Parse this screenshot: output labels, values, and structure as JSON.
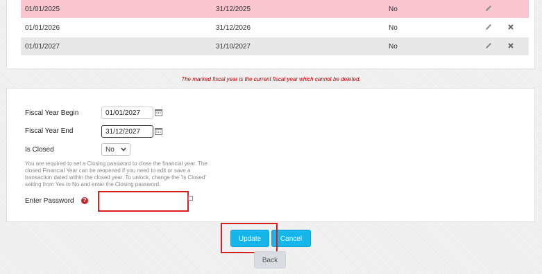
{
  "fiscal_years": [
    {
      "begin": "01/01/2025",
      "end": "31/12/2025",
      "closed": "No",
      "current": true
    },
    {
      "begin": "01/01/2026",
      "end": "31/12/2026",
      "closed": "No",
      "current": false
    },
    {
      "begin": "01/01/2027",
      "end": "31/10/2027",
      "closed": "No",
      "current": false
    }
  ],
  "warning": "The marked fiscal year is the current fiscal year which cannot be deleted.",
  "form": {
    "begin_label": "Fiscal Year Begin",
    "begin_value": "01/01/2027",
    "end_label": "Fiscal Year End",
    "end_value": "31/12/2027",
    "closed_label": "Is Closed",
    "closed_value": "No",
    "help_text": "You are required to set a Closing password to close the financial year. The closed Financial Year can be reopened if you need to edit or save a transaction dated within the closed year. To unlock, change the 'Is Closed' setting from Yes to No and enter the Closing password.",
    "password_label": "Enter Password",
    "password_help_glyph": "?",
    "password_value": ""
  },
  "buttons": {
    "update": "Update",
    "cancel": "Cancel",
    "back": "Back"
  },
  "colors": {
    "current_row": "#f9c6cf",
    "alt_row": "#e8e8e8",
    "primary": "#13b5ea",
    "highlight": "#d81e1e",
    "warning": "#c00000"
  }
}
